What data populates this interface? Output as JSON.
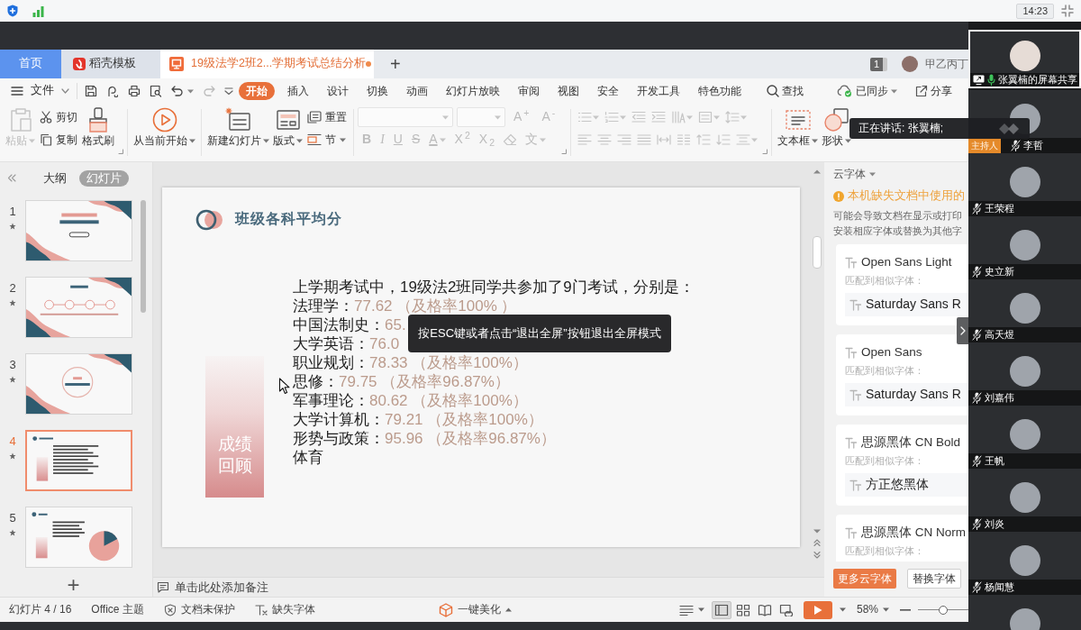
{
  "system_bar": {
    "time": "14:23"
  },
  "app_tabs": [
    {
      "label": "首页",
      "kind": "home",
      "selected": false
    },
    {
      "label": "稻壳模板",
      "kind": "docer",
      "selected": false
    },
    {
      "label": "19级法学2班2...学期考试总结分析",
      "kind": "document",
      "selected": true,
      "modified": true
    }
  ],
  "new_tab": "+",
  "account": {
    "badge": "1",
    "name": "甲乙丙丁"
  },
  "menu": {
    "file": "文件",
    "tabs": [
      {
        "label": "开始",
        "selected": true
      },
      {
        "label": "插入",
        "selected": false
      },
      {
        "label": "设计",
        "selected": false
      },
      {
        "label": "切换",
        "selected": false
      },
      {
        "label": "动画",
        "selected": false
      },
      {
        "label": "幻灯片放映",
        "selected": false
      },
      {
        "label": "审阅",
        "selected": false
      },
      {
        "label": "视图",
        "selected": false
      },
      {
        "label": "安全",
        "selected": false
      },
      {
        "label": "开发工具",
        "selected": false
      },
      {
        "label": "特色功能",
        "selected": false
      }
    ],
    "search": "查找",
    "sync": "已同步",
    "share": "分享"
  },
  "ribbon": {
    "clipboard": [
      {
        "label": "粘贴",
        "dropdown": true,
        "disabled": true
      },
      {
        "label": "剪切",
        "dropdown": false,
        "disabled": false
      },
      {
        "label": "复制",
        "dropdown": false,
        "disabled": false
      },
      {
        "label": "格式刷",
        "dropdown": false,
        "disabled": false
      }
    ],
    "slideshow": [
      {
        "label": "从当前开始",
        "dropdown": true,
        "disabled": false
      }
    ],
    "slides": [
      {
        "label": "新建幻灯片",
        "dropdown": true,
        "disabled": false
      },
      {
        "label": "版式",
        "dropdown": true,
        "disabled": false
      },
      {
        "label": "重置",
        "dropdown": false,
        "disabled": false
      },
      {
        "label": "节",
        "dropdown": true,
        "disabled": false
      }
    ],
    "font": {
      "disabled": true,
      "size_buttons": [
        "A$^{+}$",
        "A$^{-}$"
      ],
      "styles": [
        "B",
        "I",
        "U",
        "S",
        "A",
        "X$^{2}$",
        "X$_{2}$"
      ],
      "effect": "文"
    },
    "paragraph": {
      "disabled": true
    },
    "insert": [
      {
        "label": "文本框",
        "dropdown": true,
        "disabled": false
      },
      {
        "label": "形状",
        "dropdown": true,
        "disabled": false
      }
    ]
  },
  "slide_panel": {
    "views": [
      {
        "label": "大纲",
        "selected": false
      },
      {
        "label": "幻灯片",
        "selected": true
      }
    ],
    "slides": [
      {
        "number": "1",
        "kind": "title",
        "animated": true,
        "selected": false
      },
      {
        "number": "2",
        "kind": "contents",
        "animated": true,
        "selected": false
      },
      {
        "number": "3",
        "kind": "section",
        "animated": true,
        "selected": false
      },
      {
        "number": "4",
        "kind": "text",
        "animated": true,
        "selected": true
      },
      {
        "number": "5",
        "kind": "chart",
        "animated": true,
        "selected": false
      }
    ],
    "add": "+"
  },
  "slide": {
    "title": "班级各科平均分",
    "banner": "成绩回顾",
    "intro": "上学期考试中，19级法2班同学共参加了9门考试，分别是：",
    "subjects": [
      {
        "name": "法理学：",
        "score": "77.62 （及格率100% ）"
      },
      {
        "name": "中国法制史：",
        "score": "65."
      },
      {
        "name": "大学英语：",
        "score": "76.0"
      },
      {
        "name": "职业规划：",
        "score": "78.33 （及格率100%）"
      },
      {
        "name": "思修：",
        "score": "79.75 （及格率96.87%）"
      },
      {
        "name": "军事理论：",
        "score": "80.62 （及格率100%）"
      },
      {
        "name": "大学计算机：",
        "score": "79.21 （及格率100%）"
      },
      {
        "name": "形势与政策：",
        "score": "95.96 （及格率96.87%）"
      },
      {
        "name": "体育"
      }
    ]
  },
  "toast": "按ESC键或者点击“退出全屏”按钮退出全屏模式",
  "notes": {
    "placeholder": "单击此处添加备注"
  },
  "font_panel": {
    "title": "云字体",
    "warning": "本机缺失文档中使用的",
    "description": [
      "可能会导致文档在显示或打印",
      "安装相应字体或替换为其他字"
    ],
    "fonts": [
      {
        "missing": "Open Sans Light",
        "match_label": "匹配到相似字体：",
        "match": "Saturday Sans R"
      },
      {
        "missing": "Open Sans",
        "match_label": "匹配到相似字体：",
        "match": "Saturday Sans R"
      },
      {
        "missing": "思源黑体 CN Bold",
        "match_label": "匹配到相似字体：",
        "match": "方正悠黑体"
      },
      {
        "missing": "思源黑体 CN Norm",
        "match_label": "匹配到相似字体："
      }
    ],
    "buttons": [
      {
        "label": "更多云字体",
        "kind": "primary"
      },
      {
        "label": "替换字体",
        "kind": "secondary"
      }
    ]
  },
  "status_bar": {
    "slide_info": "幻灯片 4 / 16",
    "theme": "Office 主题",
    "protection": "文档未保护",
    "fonts": "缺失字体",
    "beautify": "一键美化",
    "views": [
      {
        "selected": true
      },
      {
        "selected": false
      },
      {
        "selected": false
      },
      {
        "selected": false
      }
    ],
    "zoom": "58%",
    "zoom_slider": {
      "level": 0.5
    }
  },
  "participants": [
    {
      "name": "张翼楠的屏幕共享",
      "kind": "screen",
      "muted": false,
      "selected": true
    },
    {
      "name": "李哲",
      "role": "主持人",
      "kind": "person",
      "muted": true,
      "selected": false
    },
    {
      "name": "王荣程",
      "kind": "person",
      "muted": true,
      "selected": false
    },
    {
      "name": "史立新",
      "kind": "person",
      "muted": true,
      "selected": false
    },
    {
      "name": "高天煜",
      "kind": "person",
      "muted": true,
      "selected": false
    },
    {
      "name": "刘嘉伟",
      "kind": "person",
      "muted": true,
      "selected": false
    },
    {
      "name": "王帆",
      "kind": "person",
      "muted": true,
      "selected": false
    },
    {
      "name": "刘炎",
      "kind": "person",
      "muted": true,
      "selected": false
    },
    {
      "name": "杨闻慧",
      "kind": "person",
      "muted": true,
      "selected": false
    },
    {
      "kind": "person",
      "selected": false
    }
  ],
  "speaking_tooltip": "正在讲话: 张翼楠;"
}
